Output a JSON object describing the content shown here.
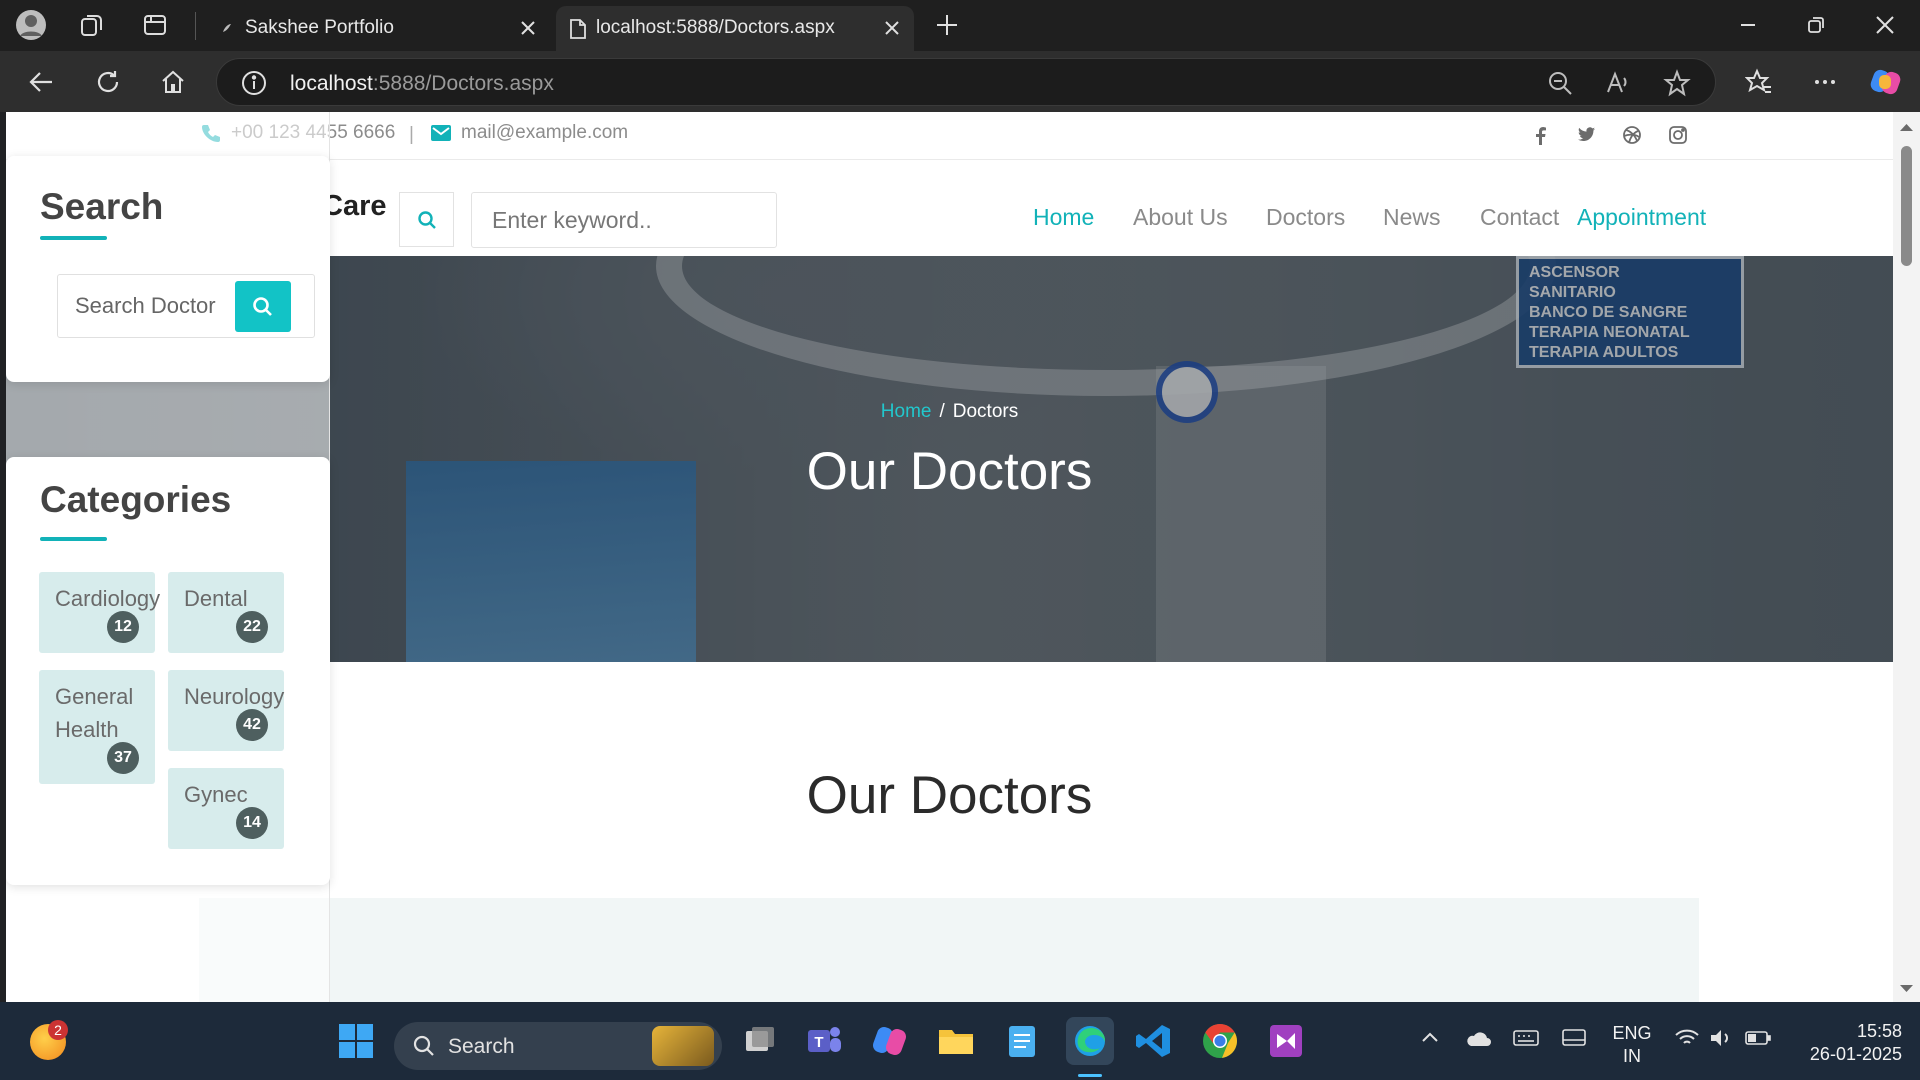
{
  "browser": {
    "tabs": [
      {
        "title": "Sakshee Portfolio",
        "active": false
      },
      {
        "title": "localhost:5888/Doctors.aspx",
        "active": true
      }
    ],
    "address": {
      "host": "localhost",
      "rest": ":5888/Doctors.aspx"
    }
  },
  "topbar": {
    "phone": "+00 123 4455 6666",
    "divider": "|",
    "email": "mail@example.com"
  },
  "navbar": {
    "brand_fragment": "Care",
    "search_placeholder": "Enter keyword..",
    "links": [
      {
        "label": "Home",
        "active": true
      },
      {
        "label": "About Us"
      },
      {
        "label": "Doctors"
      },
      {
        "label": "News"
      },
      {
        "label": "Contact"
      },
      {
        "label": "Appointment",
        "accent": true
      }
    ]
  },
  "hero": {
    "breadcrumb": {
      "home": "Home",
      "separator": "/",
      "current": "Doctors"
    },
    "title": "Our Doctors",
    "sign_lines": [
      "ASCENSOR",
      "SANITARIO",
      "BANCO DE SANGRE",
      "TERAPIA NEONATAL",
      "TERAPIA ADULTOS"
    ]
  },
  "section": {
    "title": "Our Doctors"
  },
  "sidebar": {
    "search": {
      "title": "Search",
      "placeholder": "Search Doctor"
    },
    "categories": {
      "title": "Categories",
      "items": [
        {
          "label": "Cardiology",
          "count": "12"
        },
        {
          "label": "Dental",
          "count": "22"
        },
        {
          "label": "General\nHealth",
          "count": "37"
        },
        {
          "label": "Neurology",
          "count": "42"
        },
        {
          "label": "Gynec",
          "count": "14"
        }
      ]
    }
  },
  "taskbar": {
    "notification_badge": "2",
    "search_label": "Search",
    "language": "ENG",
    "region": "IN",
    "time": "15:58",
    "date": "26-01-2025"
  },
  "colors": {
    "accent": "#12b2b8",
    "category_bg": "#d7ecec",
    "badge_bg": "#4e5f5f"
  }
}
